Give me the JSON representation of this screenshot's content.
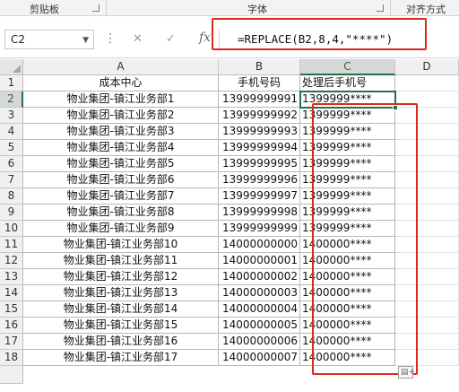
{
  "ribbon": {
    "groups": [
      {
        "label": "剪贴板"
      },
      {
        "label": "字体"
      },
      {
        "label": "对齐方式"
      }
    ]
  },
  "formula_bar": {
    "name_box": "C2",
    "cancel_icon": "✕",
    "enter_icon": "✓",
    "fx_label": "fx",
    "formula": "=REPLACE(B2,8,4,\"****\")"
  },
  "sheet": {
    "columns": [
      "A",
      "B",
      "C",
      "D"
    ],
    "header_row": {
      "row": "1",
      "a": "成本中心",
      "b": "手机号码",
      "c": "处理后手机号"
    },
    "rows": [
      {
        "row": "2",
        "a": "物业集团-镇江业务部1",
        "b": "13999999991",
        "c": "1399999****"
      },
      {
        "row": "3",
        "a": "物业集团-镇江业务部2",
        "b": "13999999992",
        "c": "1399999****"
      },
      {
        "row": "4",
        "a": "物业集团-镇江业务部3",
        "b": "13999999993",
        "c": "1399999****"
      },
      {
        "row": "5",
        "a": "物业集团-镇江业务部4",
        "b": "13999999994",
        "c": "1399999****"
      },
      {
        "row": "6",
        "a": "物业集团-镇江业务部5",
        "b": "13999999995",
        "c": "1399999****"
      },
      {
        "row": "7",
        "a": "物业集团-镇江业务部6",
        "b": "13999999996",
        "c": "1399999****"
      },
      {
        "row": "8",
        "a": "物业集团-镇江业务部7",
        "b": "13999999997",
        "c": "1399999****"
      },
      {
        "row": "9",
        "a": "物业集团-镇江业务部8",
        "b": "13999999998",
        "c": "1399999****"
      },
      {
        "row": "10",
        "a": "物业集团-镇江业务部9",
        "b": "13999999999",
        "c": "1399999****"
      },
      {
        "row": "11",
        "a": "物业集团-镇江业务部10",
        "b": "14000000000",
        "c": "1400000****"
      },
      {
        "row": "12",
        "a": "物业集团-镇江业务部11",
        "b": "14000000001",
        "c": "1400000****"
      },
      {
        "row": "13",
        "a": "物业集团-镇江业务部12",
        "b": "14000000002",
        "c": "1400000****"
      },
      {
        "row": "14",
        "a": "物业集团-镇江业务部13",
        "b": "14000000003",
        "c": "1400000****"
      },
      {
        "row": "15",
        "a": "物业集团-镇江业务部14",
        "b": "14000000004",
        "c": "1400000****"
      },
      {
        "row": "16",
        "a": "物业集团-镇江业务部15",
        "b": "14000000005",
        "c": "1400000****"
      },
      {
        "row": "17",
        "a": "物业集团-镇江业务部16",
        "b": "14000000006",
        "c": "1400000****"
      },
      {
        "row": "18",
        "a": "物业集团-镇江业务部17",
        "b": "14000000007",
        "c": "1400000****"
      }
    ]
  },
  "colors": {
    "highlight_red": "#e0271e",
    "excel_green": "#217346"
  }
}
